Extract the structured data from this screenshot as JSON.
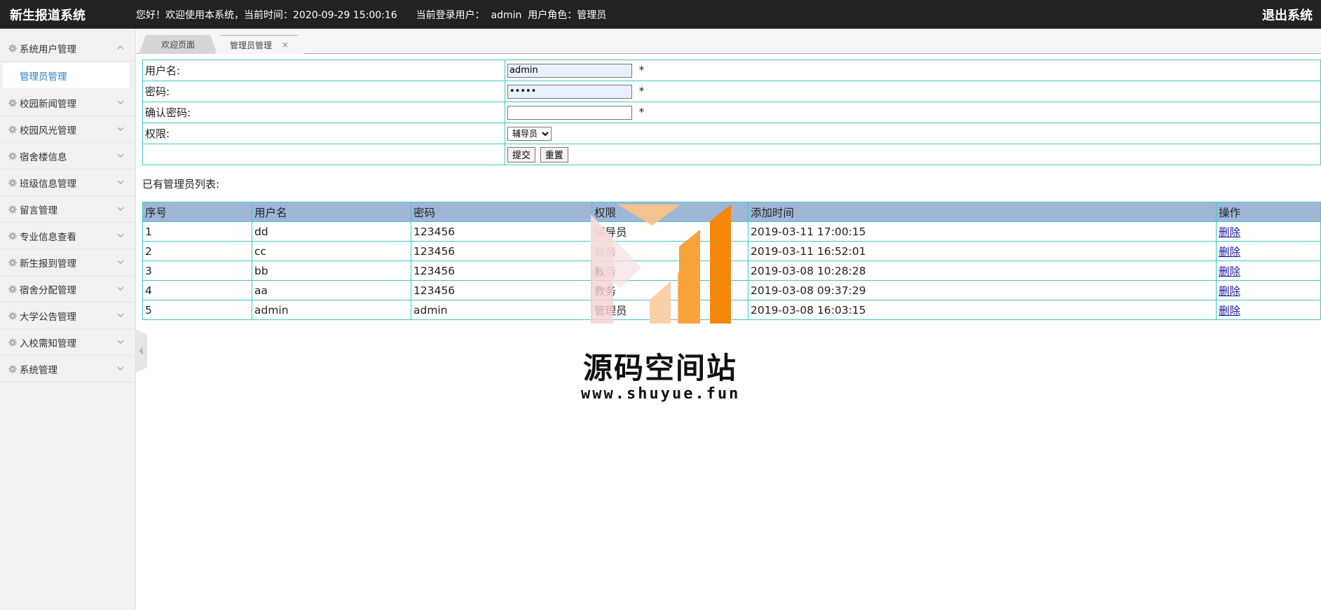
{
  "header": {
    "brand": "新生报道系统",
    "greeting": "您好！欢迎使用本系统，当前时间：2020-09-29 15:00:16",
    "login_user": "当前登录用户：  admin  用户角色：管理员",
    "logout": "退出系统"
  },
  "sidebar": {
    "groups": [
      {
        "label": "系统用户管理",
        "expanded": true,
        "children": [
          "管理员管理"
        ]
      },
      {
        "label": "校园新闻管理"
      },
      {
        "label": "校园风光管理"
      },
      {
        "label": "宿舍楼信息"
      },
      {
        "label": "班级信息管理"
      },
      {
        "label": "留言管理"
      },
      {
        "label": "专业信息查看"
      },
      {
        "label": "新生报到管理"
      },
      {
        "label": "宿舍分配管理"
      },
      {
        "label": "大学公告管理"
      },
      {
        "label": "入校需知管理"
      },
      {
        "label": "系统管理"
      }
    ]
  },
  "tabs": [
    {
      "label": "欢迎页面"
    },
    {
      "label": "管理员管理",
      "close": "×",
      "active": true
    }
  ],
  "form": {
    "username_label": "用户名:",
    "username_value": "admin",
    "password_label": "密码:",
    "password_value": "admin",
    "confirm_label": "确认密码:",
    "confirm_value": "",
    "role_label": "权限:",
    "role_selected": "辅导员",
    "required_mark": "*",
    "submit": "提交",
    "reset": "重置"
  },
  "list": {
    "title": "已有管理员列表:",
    "columns": [
      "序号",
      "用户名",
      "密码",
      "权限",
      "添加时间",
      "操作"
    ],
    "rows": [
      {
        "no": "1",
        "user": "dd",
        "pwd": "123456",
        "role": "辅导员",
        "time": "2019-03-11 17:00:15",
        "action": "删除"
      },
      {
        "no": "2",
        "user": "cc",
        "pwd": "123456",
        "role": "教务",
        "time": "2019-03-11 16:52:01",
        "action": "删除"
      },
      {
        "no": "3",
        "user": "bb",
        "pwd": "123456",
        "role": "教务",
        "time": "2019-03-08 10:28:28",
        "action": "删除"
      },
      {
        "no": "4",
        "user": "aa",
        "pwd": "123456",
        "role": "教务",
        "time": "2019-03-08 09:37:29",
        "action": "删除"
      },
      {
        "no": "5",
        "user": "admin",
        "pwd": "admin",
        "role": "管理员",
        "time": "2019-03-08 16:03:15",
        "action": "删除"
      }
    ]
  },
  "watermark": {
    "text": "源码空间站",
    "url": "www.shuyue.fun"
  },
  "colors": {
    "header_bg": "#222222",
    "table_border": "#40c8c8",
    "table_head_bg": "#9fb6d6",
    "active_link": "#2a7fc2",
    "watermark_orange": "#f5870a"
  }
}
